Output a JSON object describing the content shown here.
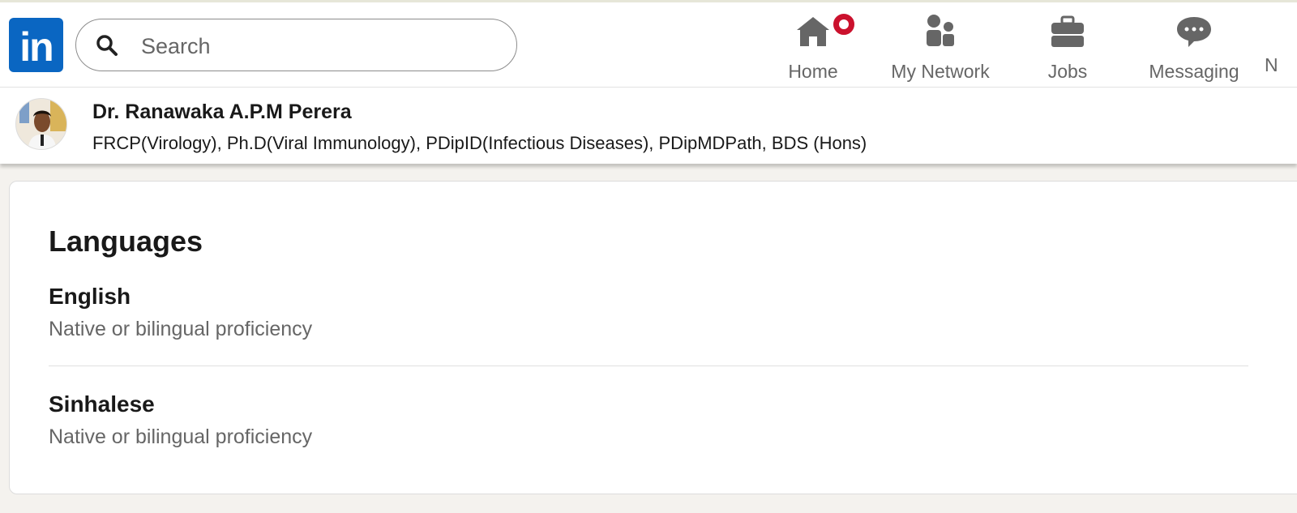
{
  "nav": {
    "logo_text": "in",
    "search_placeholder": "Search",
    "items": [
      {
        "label": "Home",
        "icon": "home-icon",
        "has_badge": true
      },
      {
        "label": "My Network",
        "icon": "people-icon"
      },
      {
        "label": "Jobs",
        "icon": "briefcase-icon"
      },
      {
        "label": "Messaging",
        "icon": "message-icon"
      }
    ],
    "truncated_next": "N"
  },
  "profile": {
    "name": "Dr. Ranawaka A.P.M Perera",
    "headline": "FRCP(Virology), Ph.D(Viral Immunology), PDipID(Infectious Diseases), PDipMDPath, BDS (Hons)"
  },
  "languages": {
    "title": "Languages",
    "items": [
      {
        "name": "English",
        "proficiency": "Native or bilingual proficiency"
      },
      {
        "name": "Sinhalese",
        "proficiency": "Native or bilingual proficiency"
      }
    ]
  },
  "colors": {
    "brand": "#0a66c2",
    "badge": "#cb112d",
    "background": "#f4f2ee"
  }
}
